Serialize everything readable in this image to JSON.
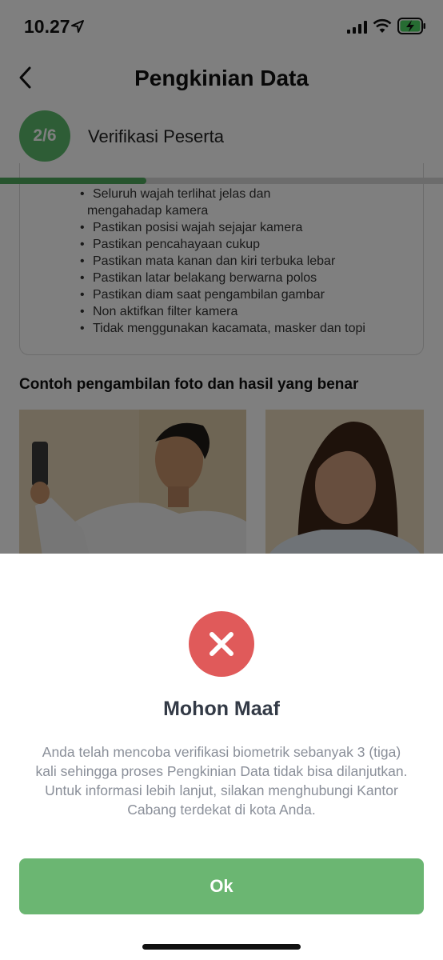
{
  "status_bar": {
    "time": "10.27"
  },
  "nav": {
    "title": "Pengkinian Data"
  },
  "step": {
    "badge": "2/6",
    "title": "Verifikasi Peserta",
    "progress": 0.33
  },
  "instructions": [
    {
      "line1": "Seluruh wajah terlihat jelas dan",
      "line2": "mengahadap kamera"
    },
    {
      "line1": "Pastikan posisi wajah sejajar kamera"
    },
    {
      "line1": "Pastikan pencahayaan cukup"
    },
    {
      "line1": "Pastikan mata kanan dan kiri terbuka lebar"
    },
    {
      "line1": "Pastikan latar belakang berwarna polos"
    },
    {
      "line1": "Pastikan diam saat pengambilan gambar"
    },
    {
      "line1": "Non aktifkan filter kamera"
    },
    {
      "line1": "Tidak menggunakan kacamata, masker dan topi"
    }
  ],
  "example_title": "Contoh pengambilan foto dan hasil yang benar",
  "dialog": {
    "title": "Mohon Maaf",
    "message": "Anda telah mencoba verifikasi biometrik sebanyak 3 (tiga) kali sehingga proses Pengkinian Data tidak bisa dilanjutkan. Untuk informasi lebih lanjut, silakan menghubungi Kantor Cabang terdekat di kota Anda.",
    "ok_label": "Ok"
  },
  "colors": {
    "primary_green": "#5cba6c",
    "button_green": "#6bb672",
    "error_red": "#e05a5a"
  },
  "icons": [
    "location-arrow-icon",
    "signal-icon",
    "wifi-icon",
    "battery-charging-icon",
    "back-chevron-icon",
    "close-x-icon"
  ]
}
